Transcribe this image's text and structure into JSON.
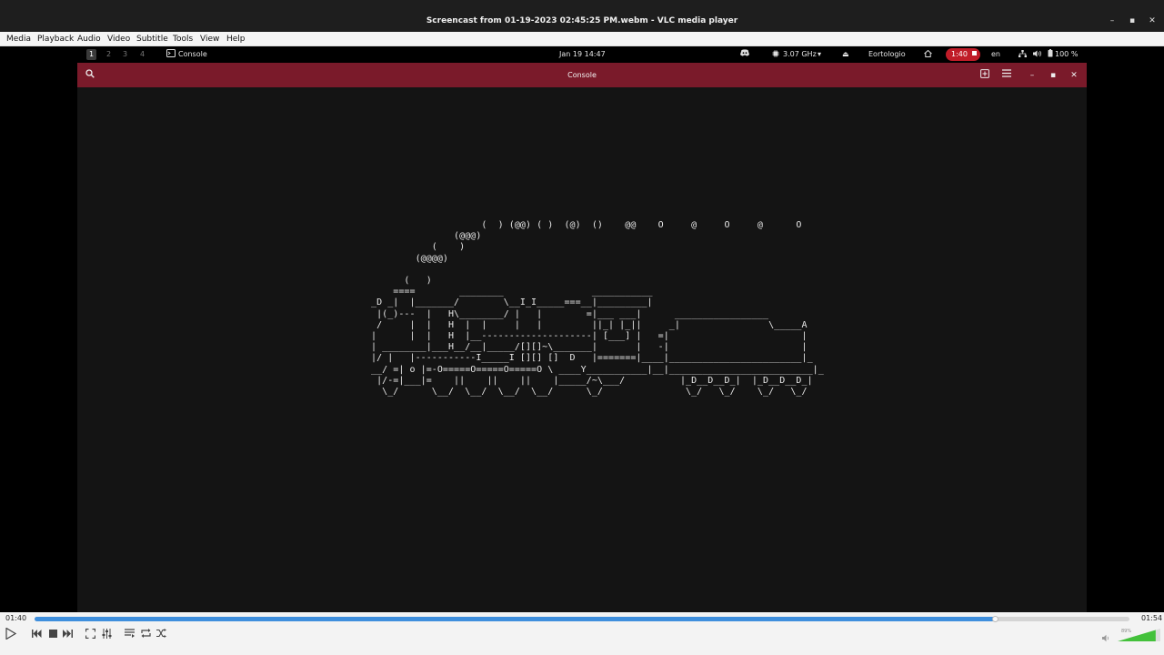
{
  "window": {
    "title": "Screencast from 01-19-2023 02:45:25 PM.webm - VLC media player",
    "minimize": "–",
    "maximize": "▪",
    "close": "✕"
  },
  "menu": [
    "Media",
    "Playback",
    "Audio",
    "Video",
    "Subtitle",
    "Tools",
    "View",
    "Help"
  ],
  "gnome_bar": {
    "workspaces": [
      "1",
      "2",
      "3",
      "4"
    ],
    "app_name": "Console",
    "clock": "Jan 19  14:47",
    "cpu": "3.07 GHz",
    "user": "Eortologio",
    "rec_time": "1:40",
    "lang": "en",
    "battery": "100 %"
  },
  "console": {
    "title": "Console",
    "ascii_art": "                    (  ) (@@) ( )  (@)  ()    @@    O     @     O     @      O\n               (@@@)\n           (    )\n        (@@@@)\n\n      (   )\n    ====        ________                ___________\n_D _|  |_______/        \\__I_I_____===__|_________|\n |(_)---  |   H\\________/ |   |        =|___ ___|      _________________\n /     |  |   H  |  |     |   |         ||_| |_||     _|                \\_____A\n|      |  |   H  |__--------------------| [___] |   =|                        |\n| ________|___H__/__|_____/[][]~\\_______|       |   -|                        |\n|/ |   |-----------I_____I [][] []  D   |=======|____|________________________|_\n__/ =| o |=-O=====O=====O=====O \\ ____Y___________|__|__________________________|_\n |/-=|___|=    ||    ||    ||    |_____/~\\___/          |_D__D__D_|  |_D__D__D_|\n  \\_/      \\__/  \\__/  \\__/  \\__/      \\_/               \\_/   \\_/    \\_/   \\_/"
  },
  "player": {
    "elapsed": "01:40",
    "total": "01:54",
    "progress": 0.877,
    "volume_percent": "89%"
  },
  "colors": {
    "console_header": "#7a1a2a",
    "rec_badge": "#c01c28",
    "seek_fill": "#3f8fdd",
    "volume_fill": "#43c13b"
  }
}
